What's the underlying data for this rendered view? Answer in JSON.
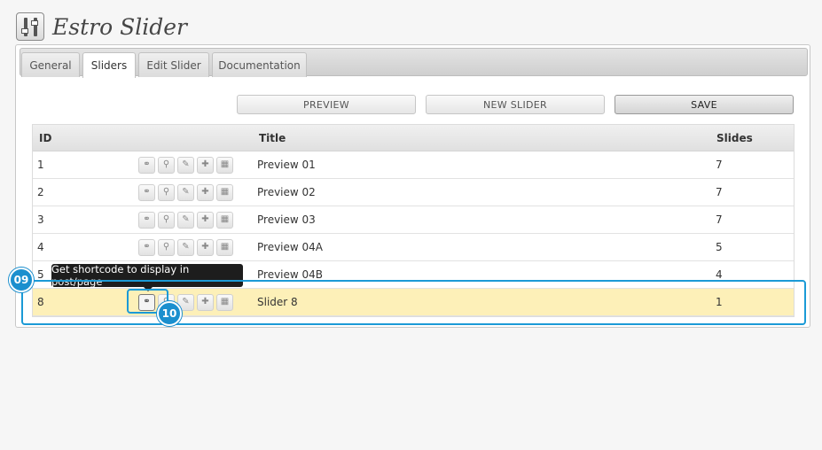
{
  "app": {
    "title": "Estro Slider",
    "icon": "sliders-settings-icon"
  },
  "tabs": [
    {
      "label": "General",
      "active": false
    },
    {
      "label": "Sliders",
      "active": true
    },
    {
      "label": "Edit Slider",
      "active": false
    },
    {
      "label": "Documentation",
      "active": false
    }
  ],
  "toolbar": {
    "preview_label": "PREVIEW",
    "new_slider_label": "NEW SLIDER",
    "save_label": "SAVE"
  },
  "table": {
    "headers": {
      "id": "ID",
      "title": "Title",
      "slides": "Slides"
    },
    "action_icons": [
      "link-icon",
      "zoom-icon",
      "edit-pencil-icon",
      "add-plus-icon",
      "trash-icon"
    ],
    "rows": [
      {
        "id": "1",
        "title": "Preview 01",
        "slides": "7"
      },
      {
        "id": "2",
        "title": "Preview 02",
        "slides": "7"
      },
      {
        "id": "3",
        "title": "Preview 03",
        "slides": "7"
      },
      {
        "id": "4",
        "title": "Preview 04A",
        "slides": "5"
      },
      {
        "id": "5",
        "title": "Preview 04B",
        "slides": "4"
      },
      {
        "id": "8",
        "title": "Slider 8",
        "slides": "1"
      }
    ]
  },
  "tooltip": {
    "text": "Get shortcode to display in post/page"
  },
  "callouts": {
    "row": "09",
    "button": "10"
  },
  "colors": {
    "highlight_row": "#fdf0b8",
    "callout": "#1b9ad6",
    "tooltip_bg": "#1d1d1d"
  }
}
